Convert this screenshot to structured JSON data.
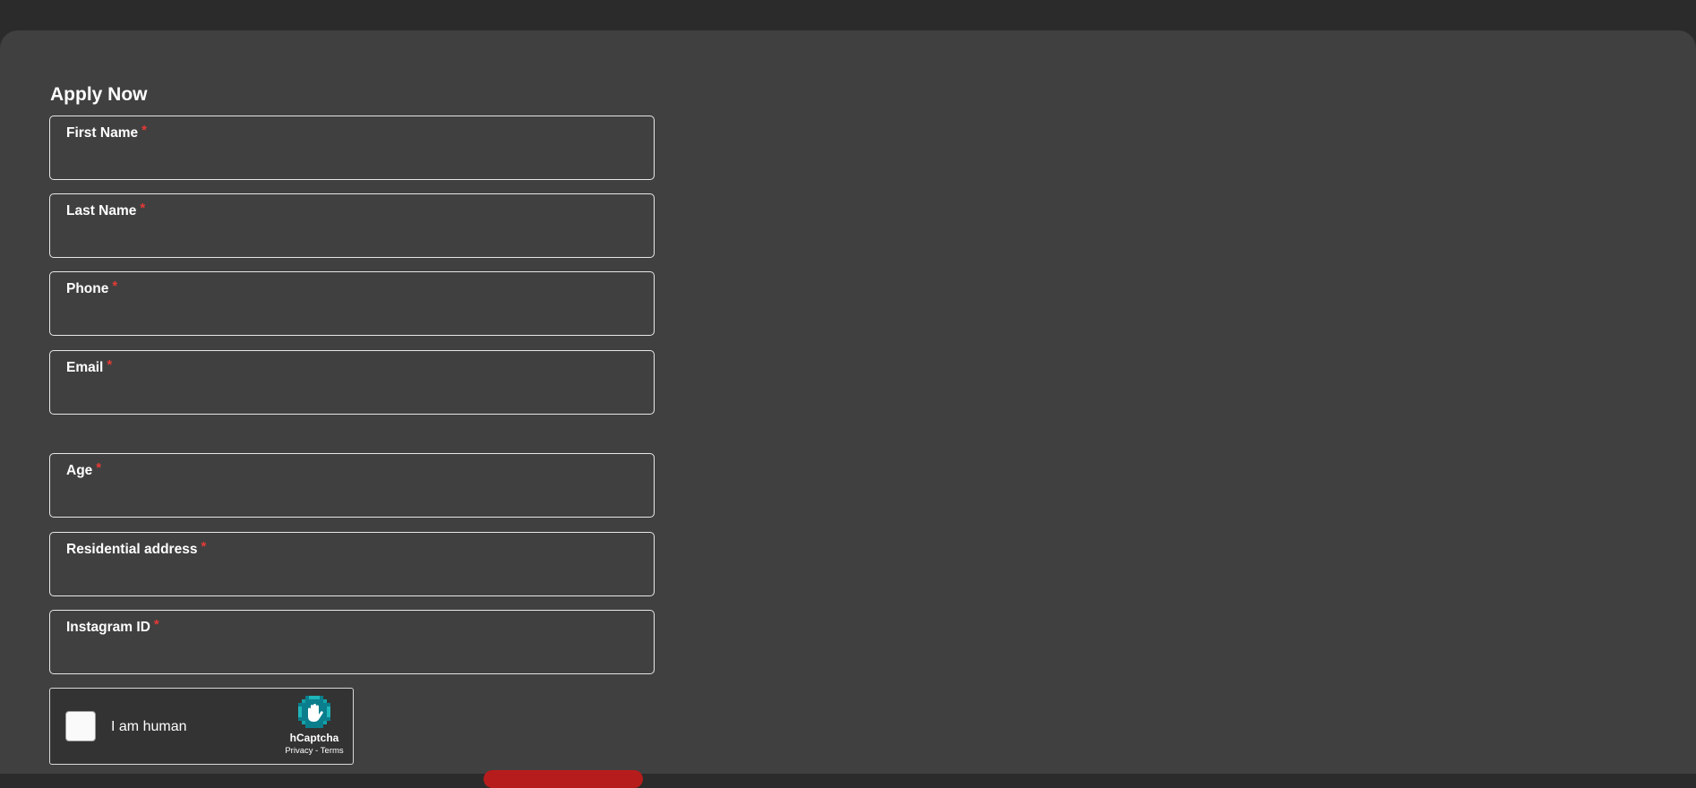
{
  "form": {
    "title": "Apply Now",
    "required_marker": "*",
    "fields": [
      {
        "label": "First Name",
        "value": "",
        "placeholder": ""
      },
      {
        "label": "Last Name",
        "value": "",
        "placeholder": ""
      },
      {
        "label": "Phone",
        "value": "",
        "placeholder": ""
      },
      {
        "label": "Email",
        "value": "",
        "placeholder": ""
      },
      {
        "label": "Age",
        "value": "",
        "placeholder": ""
      },
      {
        "label": "Residential address",
        "value": "",
        "placeholder": ""
      },
      {
        "label": "Instagram ID",
        "value": "",
        "placeholder": ""
      }
    ]
  },
  "captcha": {
    "label": "I am human",
    "brand": "hCaptcha",
    "privacy": "Privacy",
    "separator": " - ",
    "terms": "Terms",
    "logo_icon": "hcaptcha-hand-logo",
    "logo_color": "#0a7e8c",
    "checked": false
  },
  "colors": {
    "page_background": "#404040",
    "top_bar": "#2b2b2b",
    "field_border": "#e8e8e8",
    "required_marker": "#e53935",
    "submit_button": "#b71c1c"
  }
}
